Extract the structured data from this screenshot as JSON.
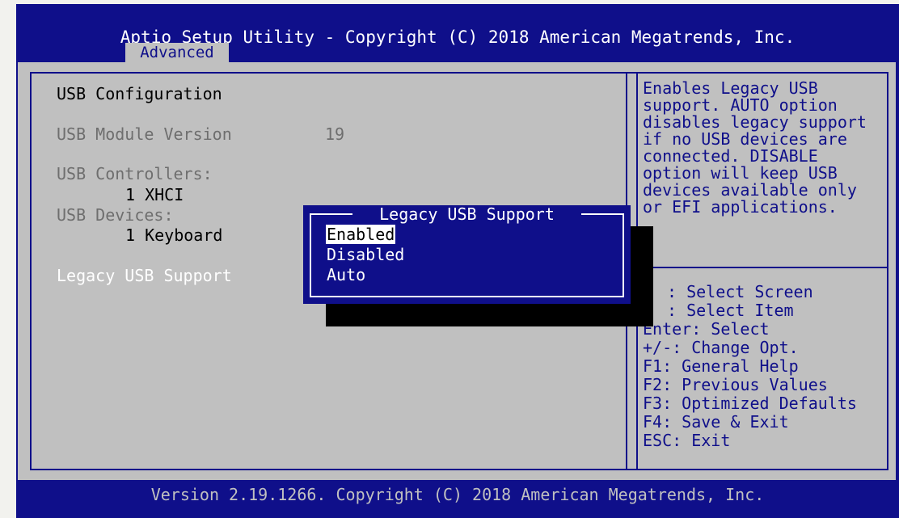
{
  "title": "Aptio Setup Utility - Copyright (C) 2018 American Megatrends, Inc.",
  "tab": "Advanced",
  "section_title": "USB Configuration",
  "module_version": {
    "label": "USB Module Version",
    "value": "19"
  },
  "controllers": {
    "label": "USB Controllers:",
    "value": "1 XHCI"
  },
  "devices": {
    "label": "USB Devices:",
    "value": "1 Keyboard"
  },
  "legacy_item": "Legacy USB Support",
  "help_lines": [
    "Enables Legacy USB",
    "support. AUTO option",
    "disables legacy support",
    "if no USB devices are",
    "connected. DISABLE",
    "option will keep USB",
    "devices available only",
    "or EFI applications."
  ],
  "key_help": [
    ": Select Screen",
    ": Select Item",
    "Enter: Select",
    "+/-: Change Opt.",
    "F1: General Help",
    "F2: Previous Values",
    "F3: Optimized Defaults",
    "F4: Save & Exit",
    "ESC: Exit"
  ],
  "popup": {
    "title": "Legacy USB Support",
    "options": [
      "Enabled",
      "Disabled",
      "Auto"
    ],
    "selected": "Enabled"
  },
  "footer": "Version 2.19.1266. Copyright (C) 2018 American Megatrends, Inc.",
  "colors": {
    "bios_blue": "#0f0f8a",
    "panel_grey": "#c0c0c0",
    "highlight": "#ffffff"
  }
}
